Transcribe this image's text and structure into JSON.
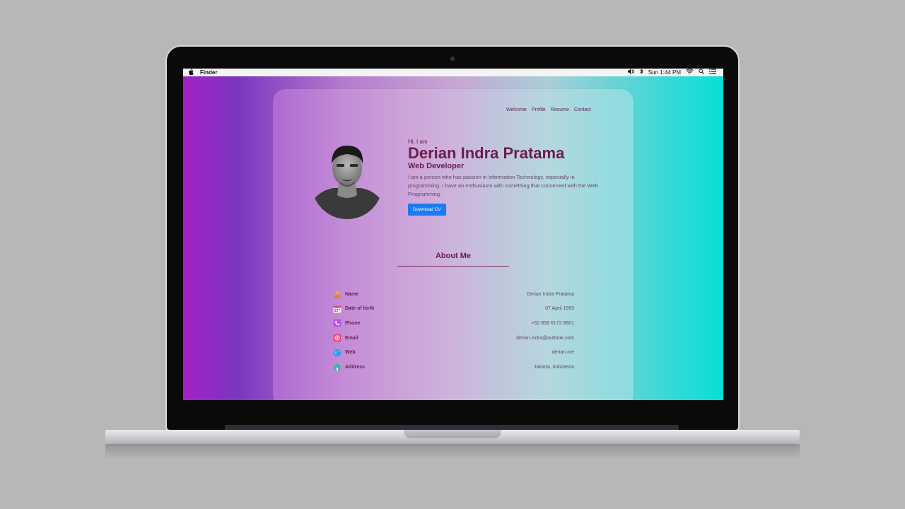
{
  "menubar": {
    "app_name": "Finder",
    "clock": "Sun 1:44 PM",
    "icons": [
      "apple-icon",
      "volume-icon",
      "bluetooth-icon",
      "wifi-icon",
      "spotlight-icon",
      "notification-center-icon"
    ]
  },
  "nav": [
    "Welcome",
    "Profile",
    "Resume",
    "Contact"
  ],
  "hero": {
    "greeting": "Hi, I am",
    "name": "Derian Indra Pratama",
    "role": "Web Developer",
    "bio": "I am a person who has passion in Information Technology, especially in programming. I have an enthusiasm with something that concerned with the Web Programming.",
    "button": "Download CV"
  },
  "about": {
    "title": "About Me",
    "rows": [
      {
        "label": "Name",
        "value": "Derian Indra Pratama",
        "icon": "person-icon"
      },
      {
        "label": "Date of birth",
        "value": "07 April 1993",
        "icon": "calendar-icon"
      },
      {
        "label": "Phone",
        "value": "+62 858 6172 8801",
        "icon": "phone-icon"
      },
      {
        "label": "Email",
        "value": "derian.indra@outlook.com",
        "icon": "mail-icon"
      },
      {
        "label": "Web",
        "value": "derian.me",
        "icon": "globe-icon"
      },
      {
        "label": "Address",
        "value": "Jakarta, Indonesia",
        "icon": "home-icon"
      }
    ]
  }
}
